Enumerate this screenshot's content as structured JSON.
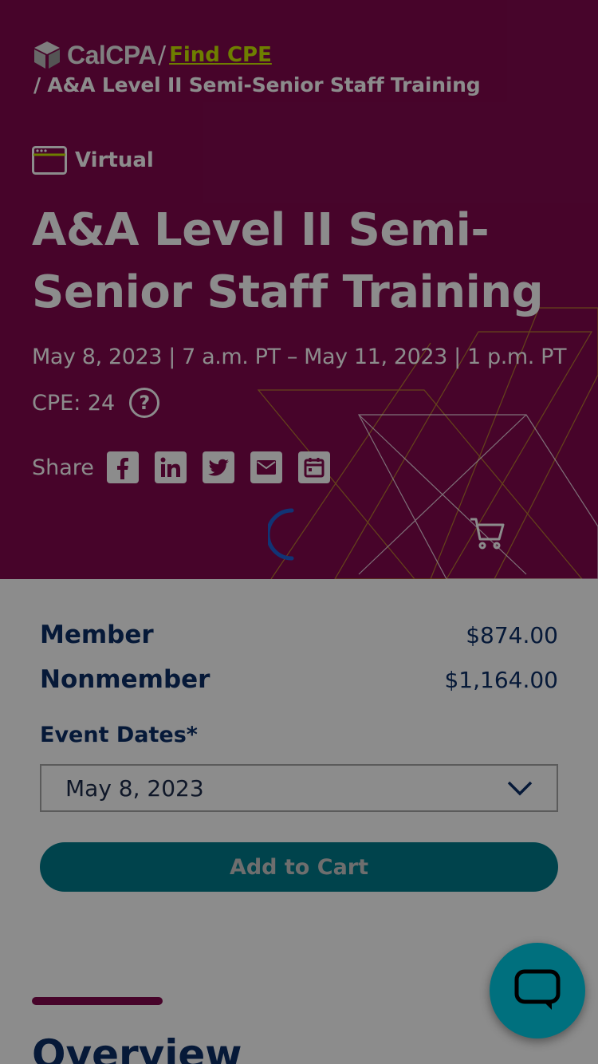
{
  "colors": {
    "hero_bg": "#82094e",
    "link": "#c8e600",
    "navy": "#0b2e66",
    "button": "#007a8a",
    "chat": "#00707e",
    "overlay": "rgba(0,0,0,0.45)"
  },
  "breadcrumb": {
    "logo_text": "CalCPA",
    "separator": "/",
    "link_label": "Find CPE",
    "current": "/ A&A Level II Semi-Senior Staff Training"
  },
  "event": {
    "format_icon": "browser-window-icon",
    "format": "Virtual",
    "title": "A&A Level II Semi-Senior Staff Training",
    "datetime": "May 8, 2023 | 7 a.m. PT – May 11, 2023 | 1 p.m. PT",
    "cpe": "CPE: 24",
    "help_icon": "question-circle-icon"
  },
  "share": {
    "label": "Share",
    "icons": [
      "facebook-icon",
      "linkedin-icon",
      "twitter-icon",
      "email-icon",
      "calendar-icon"
    ]
  },
  "pricing": {
    "member_label": "Member",
    "member_price": "$874.00",
    "nonmember_label": "Nonmember",
    "nonmember_price": "$1,164.00"
  },
  "event_dates": {
    "label": "Event Dates*",
    "selected": "May 8, 2023"
  },
  "cart": {
    "add_label": "Add to Cart"
  },
  "section": {
    "heading": "Overview"
  }
}
